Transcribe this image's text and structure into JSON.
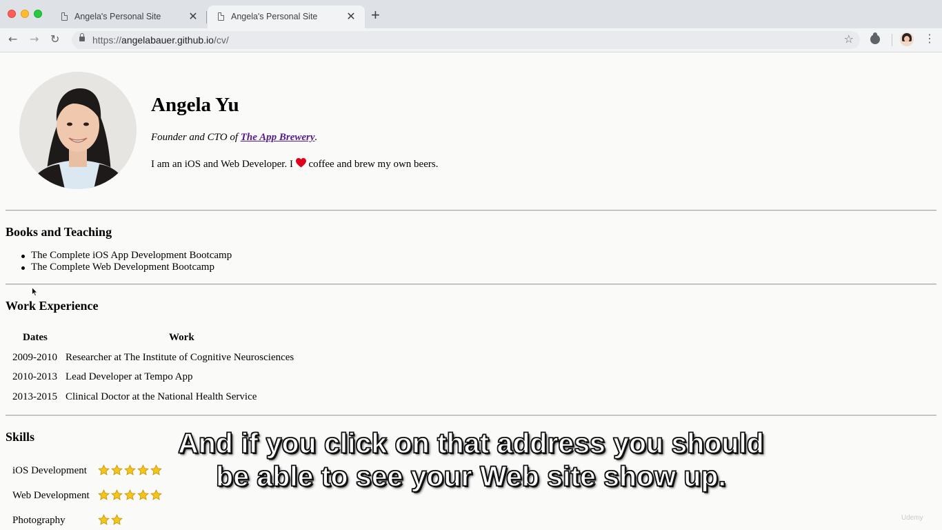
{
  "browser": {
    "tabs": [
      {
        "title": "Angela's Personal Site",
        "active": false
      },
      {
        "title": "Angela's Personal Site",
        "active": true
      }
    ],
    "new_tab_icon": "plus-icon",
    "url_scheme": "https://",
    "url_host": "angelabauer.github.io",
    "url_path": "/cv/"
  },
  "profile": {
    "name": "Angela Yu",
    "tagline_prefix": "Founder and CTO of ",
    "tagline_link": "The App Brewery",
    "tagline_suffix": ".",
    "about_before": "I am an iOS and Web Developer. I ",
    "about_after": " coffee and brew my own beers."
  },
  "books": {
    "heading": "Books and Teaching",
    "items": [
      "The Complete iOS App Development Bootcamp",
      "The Complete Web Development Bootcamp"
    ]
  },
  "work": {
    "heading": "Work Experience",
    "col_dates": "Dates",
    "col_work": "Work",
    "rows": [
      {
        "dates": "2009-2010",
        "work": "Researcher at The Institute of Cognitive Neurosciences"
      },
      {
        "dates": "2010-2013",
        "work": "Lead Developer at Tempo App"
      },
      {
        "dates": "2013-2015",
        "work": "Clinical Doctor at the National Health Service"
      }
    ]
  },
  "skills": {
    "heading": "Skills",
    "items": [
      {
        "name": "iOS Development",
        "stars": 5
      },
      {
        "name": "Web Development",
        "stars": 5
      },
      {
        "name": "Photography",
        "stars": 2
      }
    ]
  },
  "caption": {
    "line1": "And if you click on that address you should",
    "line2": "be able to see your Web site show up."
  },
  "colors": {
    "link_visited": "#551a8b",
    "heart": "#e0001b",
    "star": "#f5c518"
  },
  "watermark": "Udemy"
}
